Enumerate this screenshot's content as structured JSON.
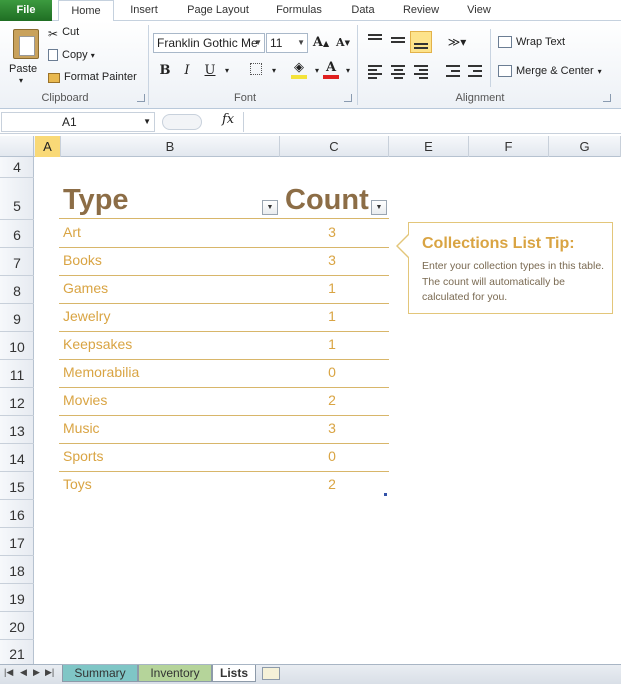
{
  "ribbon_tabs": [
    "File",
    "Home",
    "Insert",
    "Page Layout",
    "Formulas",
    "Data",
    "Review",
    "View"
  ],
  "clipboard": {
    "paste": "Paste",
    "cut": "Cut",
    "copy": "Copy",
    "format_painter": "Format Painter",
    "label": "Clipboard"
  },
  "font": {
    "family": "Franklin Gothic Me",
    "size": "11",
    "label": "Font"
  },
  "alignment": {
    "wrap_text": "Wrap Text",
    "merge_center": "Merge & Center",
    "label": "Alignment"
  },
  "formula_bar": {
    "name_box": "A1",
    "fx": "fx",
    "formula": ""
  },
  "columns": [
    "A",
    "B",
    "C",
    "E",
    "F",
    "G"
  ],
  "rows": [
    "4",
    "5",
    "6",
    "7",
    "8",
    "9",
    "10",
    "11",
    "12",
    "13",
    "14",
    "15",
    "16",
    "17",
    "18",
    "19",
    "20",
    "21"
  ],
  "table": {
    "header_type": "Type",
    "header_count": "Count",
    "rows": [
      {
        "type": "Art",
        "count": "3"
      },
      {
        "type": "Books",
        "count": "3"
      },
      {
        "type": "Games",
        "count": "1"
      },
      {
        "type": "Jewelry",
        "count": "1"
      },
      {
        "type": "Keepsakes",
        "count": "1"
      },
      {
        "type": "Memorabilia",
        "count": "0"
      },
      {
        "type": "Movies",
        "count": "2"
      },
      {
        "type": "Music",
        "count": "3"
      },
      {
        "type": "Sports",
        "count": "0"
      },
      {
        "type": "Toys",
        "count": "2"
      }
    ]
  },
  "tip": {
    "title": "Collections List Tip:",
    "body": "Enter your collection types in this table. The count will automatically be calculated for you."
  },
  "sheet_tabs": [
    "Summary",
    "Inventory",
    "Lists"
  ],
  "colors": {
    "header_text": "#8c6d46",
    "cell_text": "#d9a443",
    "tab_summary": "#7fc6c6",
    "tab_inventory": "#b5d49a",
    "file_tab": "#2e7d32"
  }
}
